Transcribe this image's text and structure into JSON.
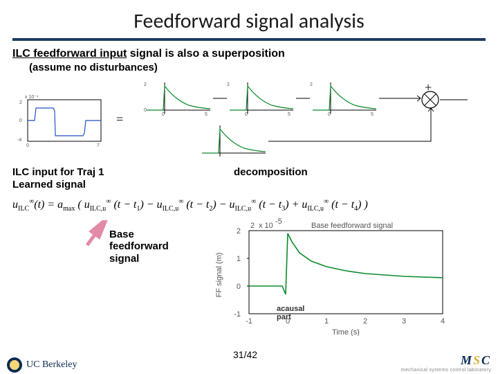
{
  "title": "Feedforward signal analysis",
  "subtitle_prefix": "ILC feedforward input",
  "subtitle_rest": " signal is also a superposition",
  "subnote": "(assume no disturbances)",
  "eq_symbol": "=",
  "plus_symbol": "+",
  "label_left_l1": "ILC input for Traj 1",
  "label_left_l2": "Learned signal",
  "label_right": "decomposition",
  "formula_html": "u<sub>ILC</sub><sup>∞</sup>(t) = a<sub>max</sub> ( u<sub>ILC,u</sub><sup>∞</sup> (t − t<sub>1</sub>) − u<sub>ILC,u</sub><sup>∞</sup> (t − t<sub>2</sub>) − u<sub>ILC,u</sub><sup>∞</sup> (t − t<sub>3</sub>) + u<sub>ILC,u</sub><sup>∞</sup> (t − t<sub>4</sub>) )",
  "base_ff_l1": "Base",
  "base_ff_l2": "feedforward",
  "base_ff_l3": "signal",
  "acausal_l1": "acausal",
  "acausal_l2": "part",
  "page_number": "31/42",
  "ucb_text": "UC Berkeley",
  "msc_plain": "MSC",
  "msc_sub": "mechanical systems control laboratory",
  "ff_chart_title": "Base feedforward signal",
  "ff_chart_ylabel": "FF signal (m)",
  "ff_chart_xlabel": "Time (s)",
  "ff_chart_yexp": "x 10",
  "ff_chart_yexp_pow": "-5",
  "mini_plot_yexp": "x 10",
  "mini_plot_yexp_pow": "-4",
  "chart_data": [
    {
      "type": "line",
      "name": "ILC input Traj 1 (learned signal)",
      "x_range": [
        0,
        7
      ],
      "y_range": [
        -4,
        2
      ],
      "y_scale": "1e-4",
      "values_y": [
        0,
        0,
        1.6,
        1.6,
        1.2,
        -3.6,
        -3.6,
        -3.2,
        0,
        0
      ],
      "values_x": [
        0,
        0.4,
        0.5,
        1.8,
        1.85,
        1.9,
        5.2,
        5.25,
        5.3,
        7
      ]
    },
    {
      "type": "line",
      "name": "decomposition component (green decay)",
      "x_range": [
        -2,
        6
      ],
      "y_range": [
        -1,
        2
      ],
      "y_scale": "1e-5",
      "values_x": [
        -2,
        -0.2,
        0,
        0.2,
        1,
        2,
        3,
        4,
        5,
        6
      ],
      "values_y": [
        0,
        0,
        1.9,
        1.4,
        0.8,
        0.55,
        0.42,
        0.35,
        0.3,
        0.28
      ]
    },
    {
      "type": "line",
      "name": "Base feedforward signal",
      "title": "Base feedforward signal",
      "xlabel": "Time (s)",
      "ylabel": "FF signal (m)",
      "x_range": [
        -1,
        4
      ],
      "y_range": [
        -1,
        2
      ],
      "y_scale": "1e-5",
      "x_ticks": [
        -1,
        0,
        1,
        2,
        3,
        4
      ],
      "y_ticks": [
        -1,
        0,
        1,
        2
      ],
      "values_x": [
        -1,
        -0.15,
        -0.05,
        0,
        0.1,
        0.3,
        0.6,
        1,
        1.5,
        2,
        2.5,
        3,
        3.5,
        4
      ],
      "values_y": [
        0,
        0,
        -0.3,
        1.9,
        1.6,
        1.2,
        0.9,
        0.7,
        0.55,
        0.45,
        0.4,
        0.36,
        0.33,
        0.3
      ]
    }
  ]
}
